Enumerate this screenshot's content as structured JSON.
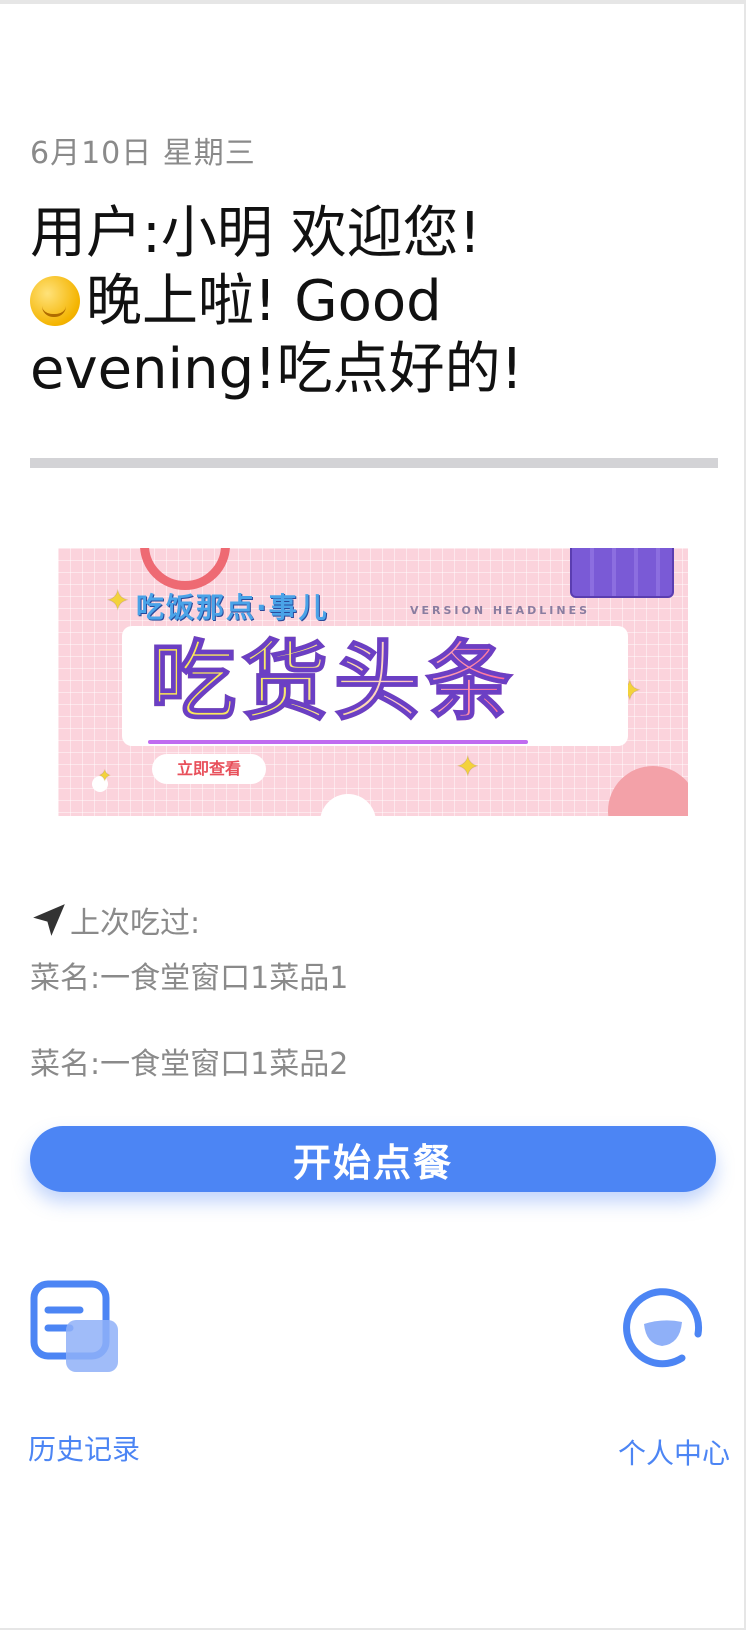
{
  "header": {
    "date": "6月10日  星期三",
    "greeting_line": "用户:小明   欢迎您!",
    "greeting_time": "晚上啦!   Good evening!吃点好的!",
    "sun_icon": "sun-face-icon"
  },
  "banner": {
    "subtitle": "吃饭那点·事儿",
    "version_text": "VERSION HEADLINES",
    "title": "吃货头条",
    "cta_label": "立即查看"
  },
  "history": {
    "heading": "上次吃过:",
    "items": [
      "菜名:一食堂窗口1菜品1",
      "菜名:一食堂窗口1菜品2"
    ]
  },
  "actions": {
    "start_order": "开始点餐"
  },
  "tabs": {
    "history_label": "历史记录",
    "profile_label": "个人中心"
  },
  "colors": {
    "accent": "#4c85f4",
    "muted_text": "#8a8a8a",
    "divider": "#d3d3d6"
  }
}
